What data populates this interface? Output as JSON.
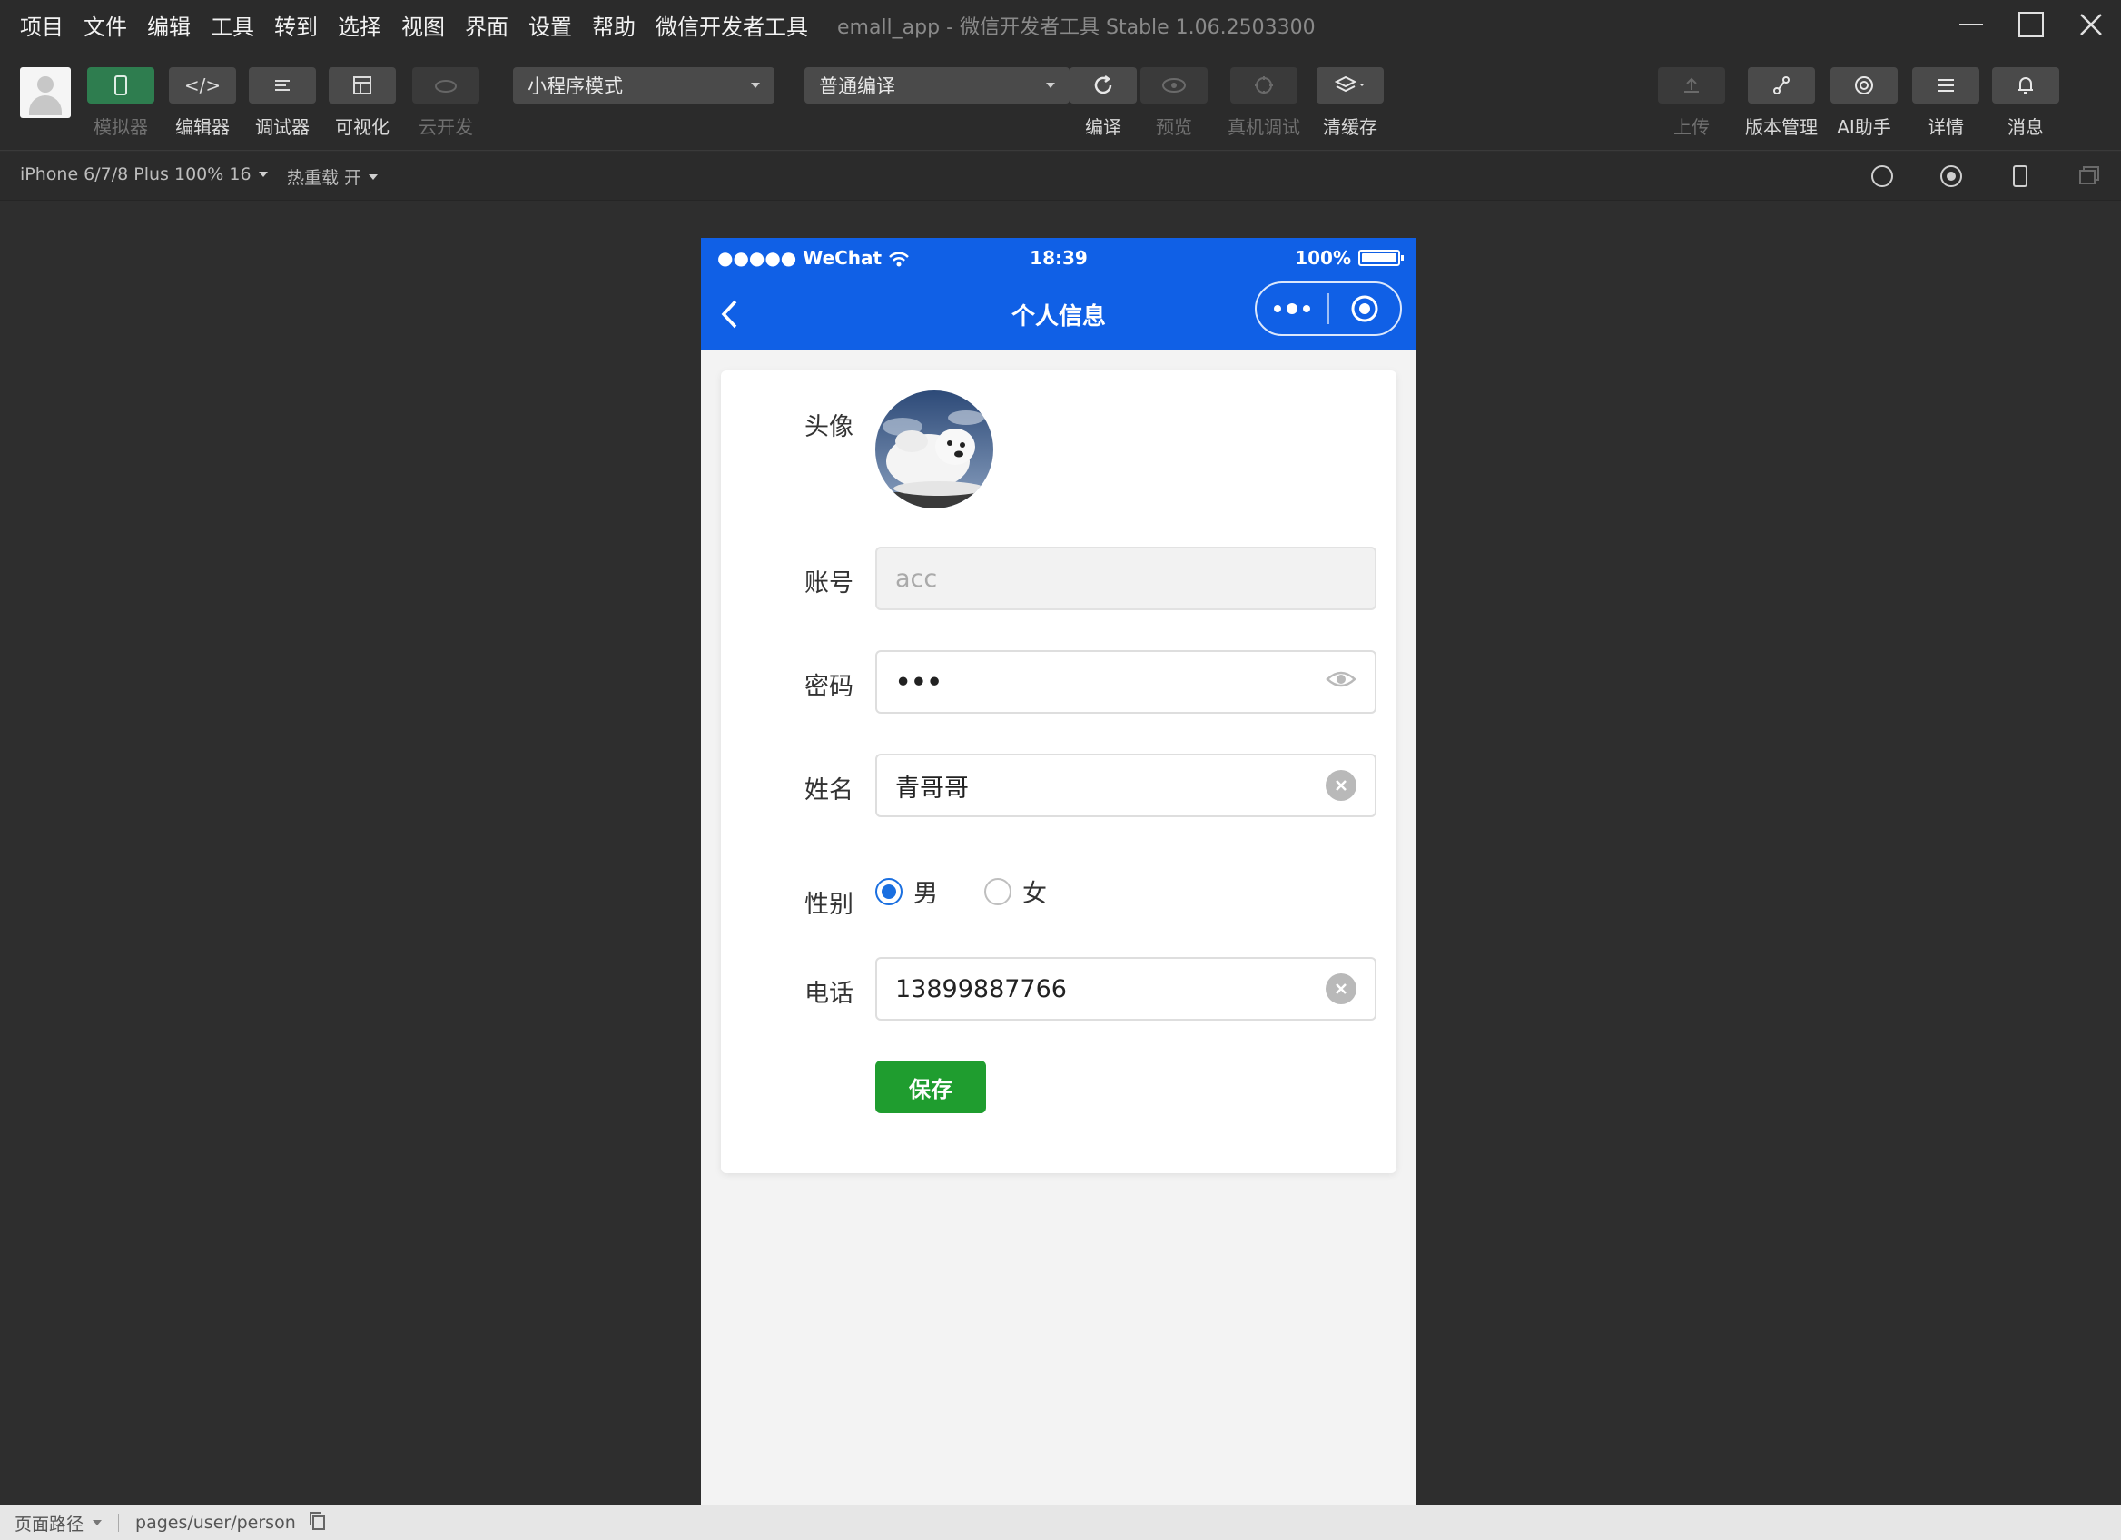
{
  "menu": [
    "项目",
    "文件",
    "编辑",
    "工具",
    "转到",
    "选择",
    "视图",
    "界面",
    "设置",
    "帮助",
    "微信开发者工具"
  ],
  "window_title": "emall_app - 微信开发者工具 Stable 1.06.2503300",
  "toolbar": {
    "left_buttons": [
      {
        "label": "模拟器",
        "icon": "phone-icon"
      },
      {
        "label": "编辑器",
        "icon": "code-icon"
      },
      {
        "label": "调试器",
        "icon": "debug-icon"
      },
      {
        "label": "可视化",
        "icon": "layout-icon"
      },
      {
        "label": "云开发",
        "icon": "cloud-icon"
      }
    ],
    "mode_select": "小程序模式",
    "compile_select": "普通编译",
    "center_buttons": [
      {
        "label": "编译",
        "icon": "refresh-icon"
      },
      {
        "label": "预览",
        "icon": "eye-icon"
      },
      {
        "label": "真机调试",
        "icon": "device-icon"
      },
      {
        "label": "清缓存",
        "icon": "layers-icon"
      }
    ],
    "right_buttons": [
      {
        "label": "上传",
        "icon": "upload-icon"
      },
      {
        "label": "版本管理",
        "icon": "branch-icon"
      },
      {
        "label": "AI助手",
        "icon": "ai-icon"
      },
      {
        "label": "详情",
        "icon": "menu-icon"
      },
      {
        "label": "消息",
        "icon": "bell-icon"
      }
    ]
  },
  "subbar": {
    "device": "iPhone 6/7/8 Plus 100% 16",
    "hotreload": "热重载 开"
  },
  "phone": {
    "status_left": "●●●●● WeChat",
    "time": "18:39",
    "battery": "100%",
    "nav_title": "个人信息"
  },
  "form": {
    "avatar_label": "头像",
    "account_label": "账号",
    "account_value": "acc",
    "password_label": "密码",
    "password_value": "•••",
    "name_label": "姓名",
    "name_value": "青哥哥",
    "gender_label": "性别",
    "gender_options": [
      "男",
      "女"
    ],
    "gender_selected": "男",
    "phone_label": "电话",
    "phone_value": "13899887766",
    "save_label": "保存"
  },
  "bottombar": {
    "path_label": "页面路径",
    "path": "pages/user/person"
  },
  "colors": {
    "nav_blue": "#1060e6",
    "save_green": "#1f9d2f",
    "radio_blue": "#1a6fe0"
  }
}
